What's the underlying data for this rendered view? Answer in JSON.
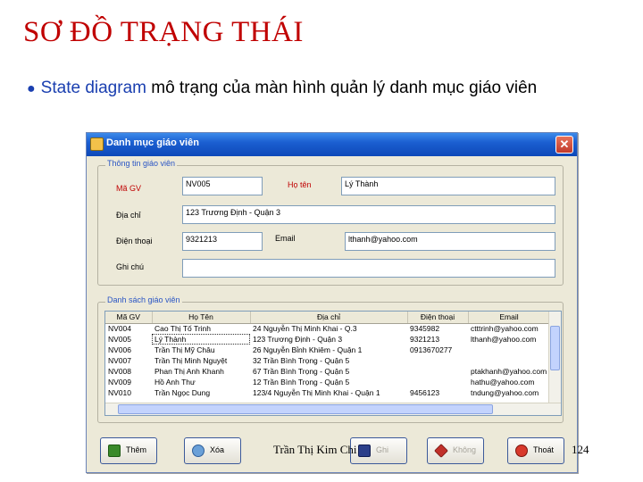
{
  "slide": {
    "title": "SƠ ĐỒ TRẠNG THÁI",
    "bullet_highlight": "State diagram",
    "bullet_text": " mô trạng của màn hình quản lý danh mục giáo viên"
  },
  "window": {
    "title": "Danh mục giáo viên",
    "close_glyph": "✕",
    "info_group_title": "Thông tin giáo viên",
    "list_group_title": "Danh sách giáo viên"
  },
  "form": {
    "ma_gv_label": "Mã GV",
    "ma_gv_value": "NV005",
    "ho_ten_label": "Họ tên",
    "ho_ten_value": "Lý Thành",
    "dia_chi_label": "Địa chỉ",
    "dia_chi_value": "123 Trương Định - Quận 3",
    "dien_thoai_label": "Điện thoại",
    "dien_thoai_value": "9321213",
    "email_label": "Email",
    "email_value": "lthanh@yahoo.com",
    "ghi_chu_label": "Ghi chú",
    "ghi_chu_value": ""
  },
  "table": {
    "columns": [
      "Mã GV",
      "Họ Tên",
      "Địa chỉ",
      "Điện thoại",
      "Email"
    ],
    "rows": [
      [
        "NV004",
        "Cao Thị Tố Trinh",
        "24 Nguyễn Thị Minh Khai - Q.3",
        "9345982",
        "ctttrinh@yahoo.com"
      ],
      [
        "NV005",
        "Lý Thành",
        "123 Trương Định - Quận 3",
        "9321213",
        "lthanh@yahoo.com"
      ],
      [
        "NV006",
        "Trần Thị Mỹ Châu",
        "26 Nguyễn Bỉnh Khiêm - Quận 1",
        "0913670277",
        ""
      ],
      [
        "NV007",
        "Trần Thị Minh Nguyệt",
        "32 Trần Bình Trọng - Quận 5",
        "",
        ""
      ],
      [
        "NV008",
        "Phan Thị Anh Khanh",
        "67 Trần Bình Trọng - Quận 5",
        "",
        "ptakhanh@yahoo.com"
      ],
      [
        "NV009",
        "Hồ Anh Thư",
        "12 Trần Bình Trọng - Quận 5",
        "",
        "hathu@yahoo.com"
      ],
      [
        "NV010",
        "Trần Ngọc Dung",
        "123/4 Nguyễn Thị Minh Khai - Quận 1",
        "9456123",
        "tndung@yahoo.com"
      ]
    ]
  },
  "buttons": {
    "them": "Thêm",
    "xoa": "Xóa",
    "ghi": "Ghi",
    "khong": "Không",
    "thoat": "Thoát"
  },
  "footer": {
    "author": "Trần Thị Kim Chi",
    "page": "124"
  },
  "colors": {
    "title_red": "#c00000",
    "bullet_blue": "#1a3fb0",
    "titlebar_blue": "#1b5fd1"
  }
}
